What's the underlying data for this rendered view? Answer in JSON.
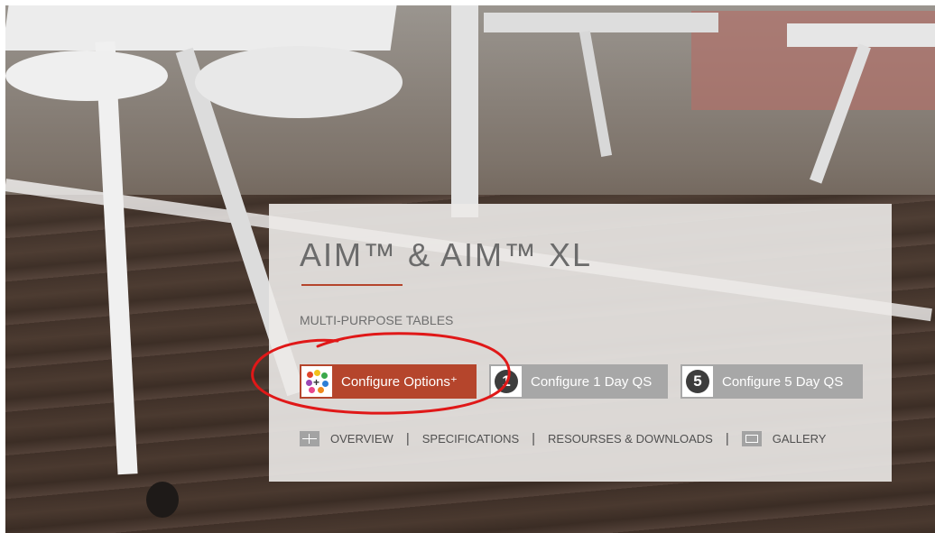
{
  "product": {
    "title": "AIM™ & AIM™ XL",
    "subtitle": "MULTI-PURPOSE TABLES"
  },
  "buttons": {
    "configure_options": "Configure Options⁺",
    "configure_1day": "Configure 1 Day QS",
    "configure_1day_badge": "1",
    "configure_5day": "Configure 5 Day QS",
    "configure_5day_badge": "5"
  },
  "nav": {
    "overview": "OVERVIEW",
    "specifications": "SPECIFICATIONS",
    "resources": "RESOURSES & DOWNLOADS",
    "gallery": "GALLERY",
    "separator": "|"
  },
  "colors": {
    "accent": "#b5452c",
    "button_gray": "#a7a7a7",
    "annotation": "#e01818"
  },
  "icons": {
    "configure": "color-palette-icon",
    "overview": "grid-icon",
    "gallery": "image-icon"
  }
}
